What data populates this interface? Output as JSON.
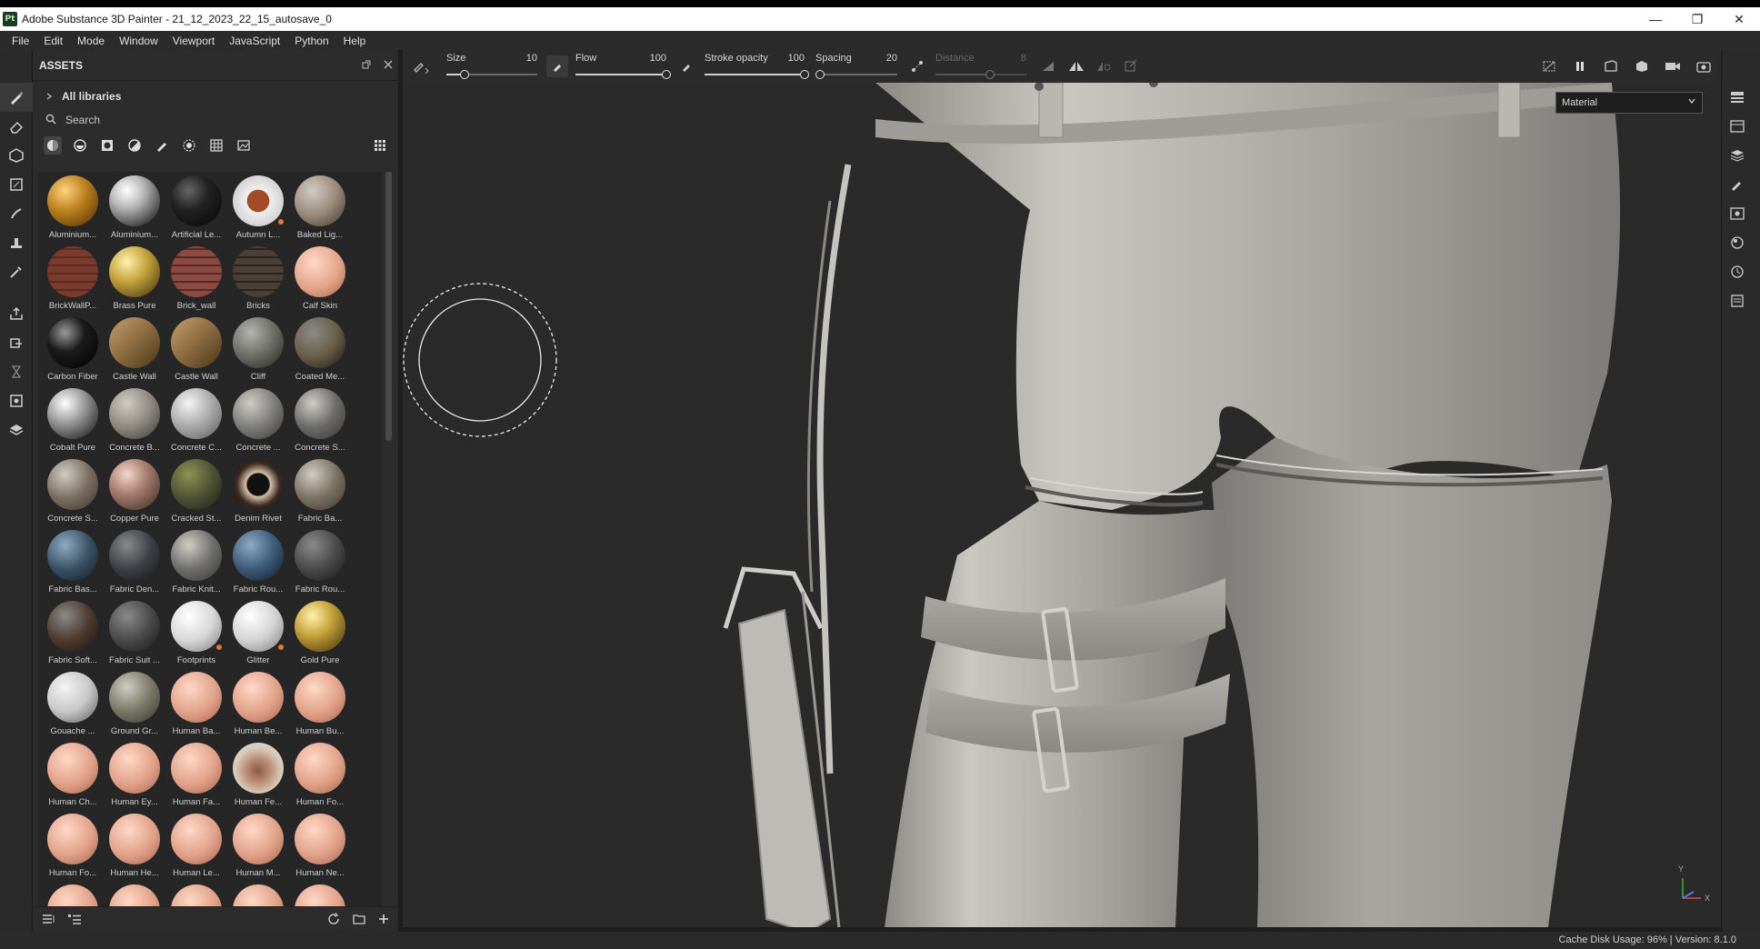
{
  "window": {
    "title": "Adobe Substance 3D Painter - 21_12_2023_22_15_autosave_0",
    "app_badge": "Pt"
  },
  "menu": [
    "File",
    "Edit",
    "Mode",
    "Window",
    "Viewport",
    "JavaScript",
    "Python",
    "Help"
  ],
  "assets": {
    "title": "ASSETS",
    "library": "All libraries",
    "search_placeholder": "Search",
    "materials": [
      {
        "label": "Aluminium...",
        "color": "#b87d1c",
        "style": "orange"
      },
      {
        "label": "Aluminium...",
        "color": "#b8b8b8",
        "style": "chrome"
      },
      {
        "label": "Artificial Le...",
        "color": "#222222",
        "style": "dark"
      },
      {
        "label": "Autumn L...",
        "color": "#f0f0f0",
        "style": "leaf",
        "badge": true
      },
      {
        "label": "Baked Lig...",
        "color": "#9a8a78",
        "style": "matte"
      },
      {
        "label": "BrickWallP...",
        "color": "#7a3a2c",
        "style": "brick"
      },
      {
        "label": "Brass Pure",
        "color": "#c7a640",
        "style": "gold"
      },
      {
        "label": "Brick_wall",
        "color": "#8a4a42",
        "style": "brick"
      },
      {
        "label": "Bricks",
        "color": "#4a3e36",
        "style": "dark-brick"
      },
      {
        "label": "Calf Skin",
        "color": "#e3a48a",
        "style": "skin"
      },
      {
        "label": "Carbon Fiber",
        "color": "#1b1b1b",
        "style": "carbon"
      },
      {
        "label": "Castle Wall",
        "color": "#8a6c40",
        "style": "cube"
      },
      {
        "label": "Castle Wall",
        "color": "#8a6c40",
        "style": "cube"
      },
      {
        "label": "Cliff",
        "color": "#6b6b66",
        "style": "rock"
      },
      {
        "label": "Coated Me...",
        "color": "#6a6048",
        "style": "matte-dark"
      },
      {
        "label": "Cobalt Pure",
        "color": "#a8a8a8",
        "style": "chrome"
      },
      {
        "label": "Concrete B...",
        "color": "#8c8880",
        "style": "matte"
      },
      {
        "label": "Concrete C...",
        "color": "#a6a6a6",
        "style": "matte-light"
      },
      {
        "label": "Concrete ...",
        "color": "#7c7c7c",
        "style": "matte"
      },
      {
        "label": "Concrete S...",
        "color": "#6a6a6a",
        "style": "matte"
      },
      {
        "label": "Concrete S...",
        "color": "#7a6e60",
        "style": "matte"
      },
      {
        "label": "Copper Pure",
        "color": "#a88070",
        "style": "copper"
      },
      {
        "label": "Cracked St...",
        "color": "#4e5234",
        "style": "moss"
      },
      {
        "label": "Denim Rivet",
        "color": "#3a2a22",
        "style": "rivet"
      },
      {
        "label": "Fabric Ba...",
        "color": "#7a7260",
        "style": "matte"
      },
      {
        "label": "Fabric Bas...",
        "color": "#3a5266",
        "style": "blue"
      },
      {
        "label": "Fabric Den...",
        "color": "#3c4046",
        "style": "matte-dark"
      },
      {
        "label": "Fabric Knit...",
        "color": "#6e6e6e",
        "style": "matte"
      },
      {
        "label": "Fabric Rou...",
        "color": "#3c5a78",
        "style": "blue"
      },
      {
        "label": "Fabric Rou...",
        "color": "#4a4a4a",
        "style": "matte-dark"
      },
      {
        "label": "Fabric Soft...",
        "color": "#4e3a2e",
        "style": "matte-dark"
      },
      {
        "label": "Fabric Suit ...",
        "color": "#4a4a4a",
        "style": "matte-dark"
      },
      {
        "label": "Footprints",
        "color": "#d8d8d8",
        "style": "white",
        "badge": true
      },
      {
        "label": "Glitter",
        "color": "#d4d4d4",
        "style": "white",
        "badge": true
      },
      {
        "label": "Gold Pure",
        "color": "#c8a43c",
        "style": "gold"
      },
      {
        "label": "Gouache ...",
        "color": "#c8c8c8",
        "style": "matte-light"
      },
      {
        "label": "Ground Gr...",
        "color": "#7a7866",
        "style": "matte"
      },
      {
        "label": "Human Ba...",
        "color": "#e0a088",
        "style": "skin"
      },
      {
        "label": "Human Be...",
        "color": "#e0a088",
        "style": "skin"
      },
      {
        "label": "Human Bu...",
        "color": "#e0a088",
        "style": "skin"
      },
      {
        "label": "Human Ch...",
        "color": "#e0a088",
        "style": "skin"
      },
      {
        "label": "Human Ey...",
        "color": "#e0a088",
        "style": "skin"
      },
      {
        "label": "Human Fa...",
        "color": "#e0a088",
        "style": "skin"
      },
      {
        "label": "Human Fe...",
        "color": "#d8c8b8",
        "style": "face"
      },
      {
        "label": "Human Fo...",
        "color": "#e0a088",
        "style": "skin"
      },
      {
        "label": "Human Fo...",
        "color": "#e0a088",
        "style": "skin"
      },
      {
        "label": "Human He...",
        "color": "#e0a088",
        "style": "skin"
      },
      {
        "label": "Human Le...",
        "color": "#e0a088",
        "style": "skin"
      },
      {
        "label": "Human M...",
        "color": "#e0a088",
        "style": "skin"
      },
      {
        "label": "Human Ne...",
        "color": "#e0a088",
        "style": "skin"
      },
      {
        "label": "",
        "color": "#e0a088",
        "style": "skin"
      },
      {
        "label": "",
        "color": "#e0a088",
        "style": "skin"
      },
      {
        "label": "",
        "color": "#e0a088",
        "style": "skin"
      },
      {
        "label": "",
        "color": "#e0a088",
        "style": "skin"
      },
      {
        "label": "",
        "color": "#e0a088",
        "style": "skin"
      }
    ]
  },
  "toolbar": {
    "size": {
      "label": "Size",
      "value": "10",
      "fraction": 0.2
    },
    "flow": {
      "label": "Flow",
      "value": "100",
      "fraction": 1.0
    },
    "stroke_opacity": {
      "label": "Stroke opacity",
      "value": "100",
      "fraction": 1.0
    },
    "spacing": {
      "label": "Spacing",
      "value": "20",
      "fraction": 0.05
    },
    "distance": {
      "label": "Distance",
      "value": "8",
      "fraction": 0.6
    }
  },
  "viewport": {
    "display_mode": "Material",
    "axis_y": "Y",
    "axis_x": "X"
  },
  "status": {
    "text": "Cache Disk Usage:  96% | Version: 8.1.0"
  },
  "colors": {
    "accent": "#e07a2c",
    "panel_bg": "#2c2c2c",
    "viewport_bg": "#2a2a2a",
    "model": "#a8a6a0"
  }
}
